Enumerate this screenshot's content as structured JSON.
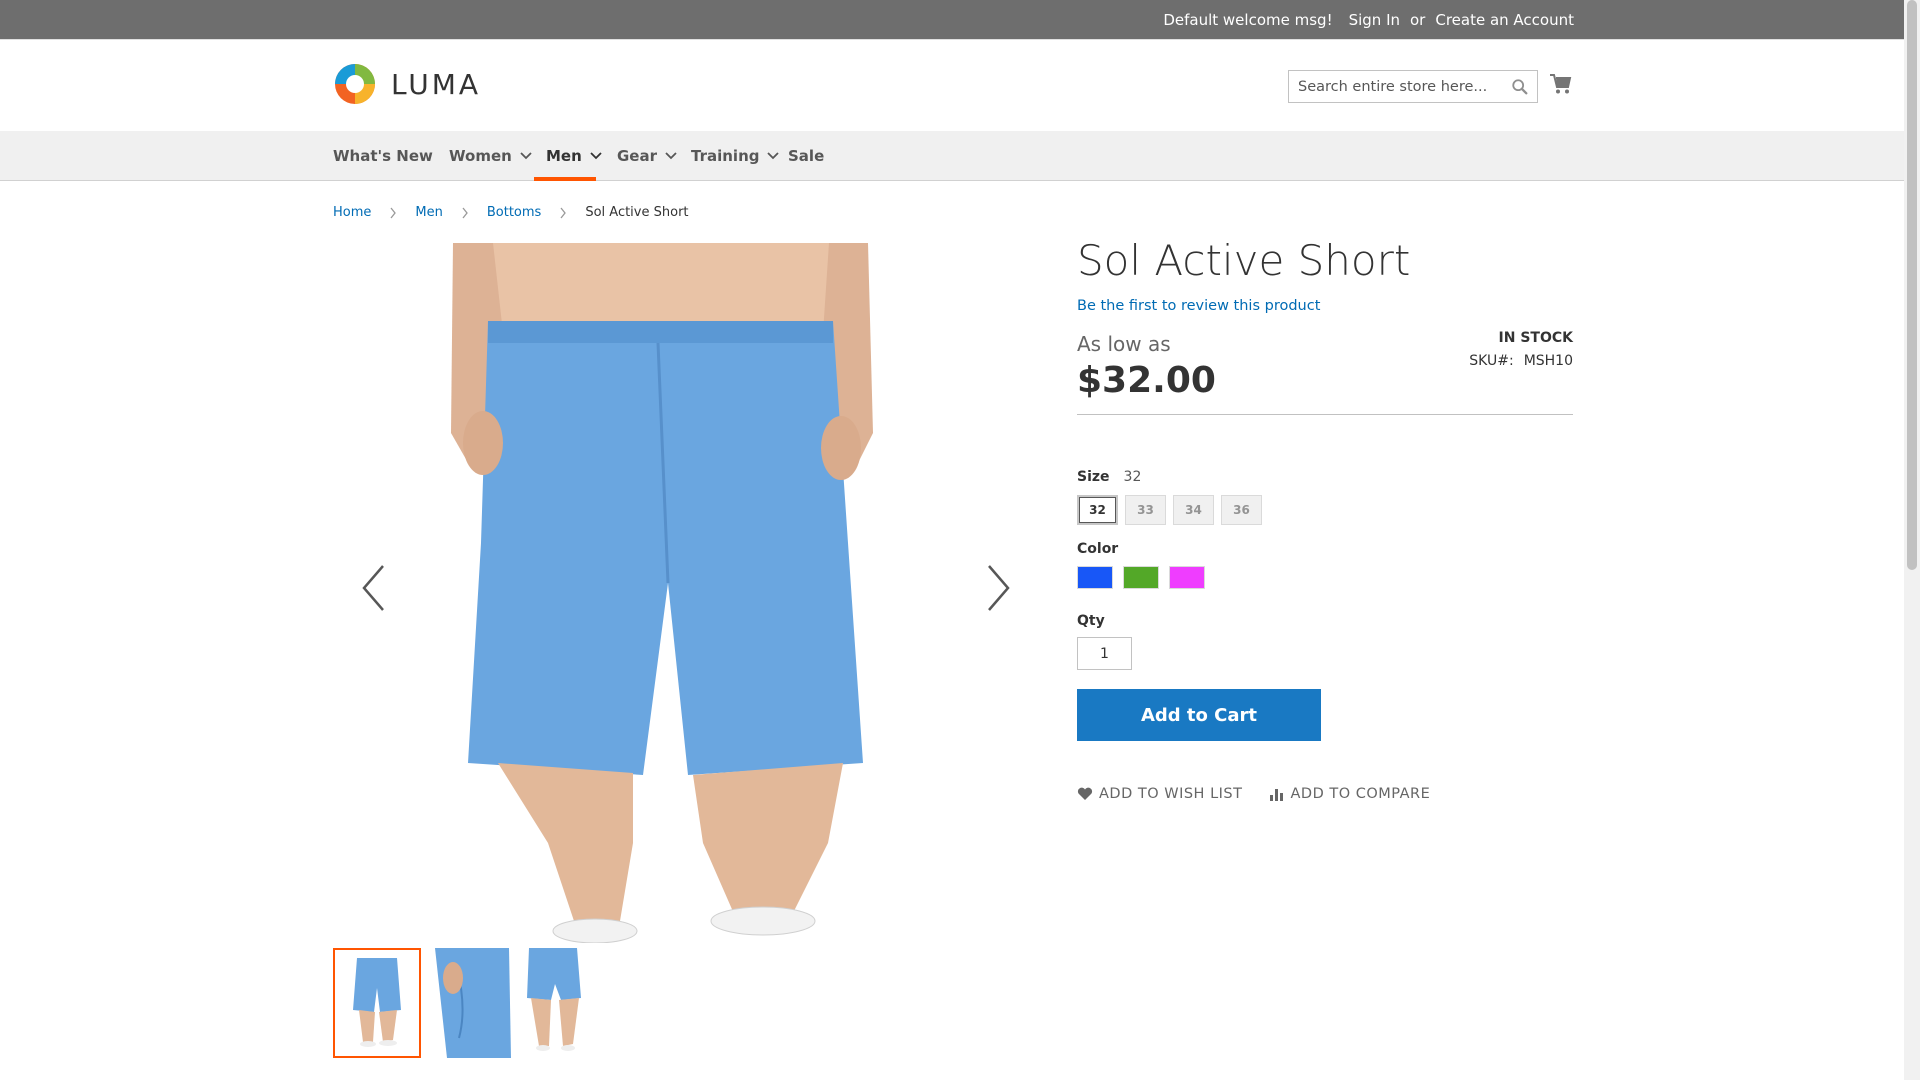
{
  "topbar": {
    "welcome": "Default welcome msg!",
    "sign_in": "Sign In",
    "or": "or",
    "create_account": "Create an Account"
  },
  "header": {
    "logo_text": "LUMA",
    "search_placeholder": "Search entire store here...",
    "cart_icon": "cart-icon",
    "search_icon": "search-icon"
  },
  "nav": {
    "items": [
      {
        "label": "What's New",
        "dropdown": false
      },
      {
        "label": "Women",
        "dropdown": true
      },
      {
        "label": "Men",
        "dropdown": true,
        "active": true
      },
      {
        "label": "Gear",
        "dropdown": true
      },
      {
        "label": "Training",
        "dropdown": true
      },
      {
        "label": "Sale",
        "dropdown": false
      }
    ],
    "accent_color": "#ff5501"
  },
  "breadcrumb": {
    "items": [
      "Home",
      "Men",
      "Bottoms"
    ],
    "current": "Sol Active Short"
  },
  "product": {
    "title": "Sol Active Short",
    "review_link": "Be the first to review this product",
    "as_low_as": "As low as",
    "price": "$32.00",
    "stock": "In stock",
    "sku_label": "SKU#:",
    "sku": "MSH10",
    "size_label": "Size",
    "size_selected": "32",
    "sizes": [
      "32",
      "33",
      "34",
      "36"
    ],
    "color_label": "Color",
    "colors": [
      "#1857f7",
      "#53a828",
      "#ef3dff"
    ],
    "qty_label": "Qty",
    "qty_value": "1",
    "add_to_cart": "Add to Cart",
    "wish_list": "Add to Wish List",
    "compare": "Add to Compare",
    "button_color": "#1979c3",
    "short_color": "#6aa6e0"
  }
}
